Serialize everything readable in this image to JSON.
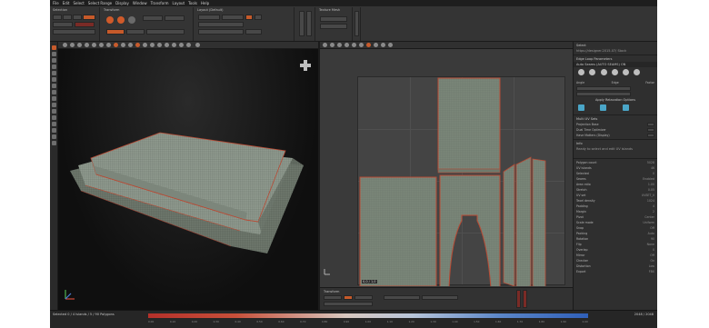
{
  "menu": [
    "File",
    "Edit",
    "Select",
    "Select Range",
    "Display",
    "Window",
    "Transform",
    "Layout",
    "Tools",
    "Help"
  ],
  "toolbar": {
    "group1_title": "Selection",
    "group2_title": "Transform",
    "group3_title": "Layout (Default)",
    "group4_title": "Texture Mesh",
    "side_tab": "Properties"
  },
  "right_panel": {
    "title": "Select",
    "path": "https://designer.2015-07/ Stock",
    "section_unfold": "Edge Loop Parameters",
    "auto_label": "Auto Seams (AUTO SEAMS) ON",
    "opt1": "Angle",
    "opt2": "Edge",
    "opt3": "Factor",
    "apply_button": "Apply Relaxation Options",
    "multi_uv": "Multi UV Sets",
    "projection": "Projection Base",
    "dual_time": "Dual Time Optimizer",
    "hide_label": "Have Matters (Display)",
    "info_header": "Info",
    "info_text": "Ready to select and edit UV islands",
    "rows": [
      {
        "k": "Polygon count",
        "v": "5028"
      },
      {
        "k": "UV islands",
        "v": "46"
      },
      {
        "k": "Selected",
        "v": "0"
      },
      {
        "k": "Seams",
        "v": "Enabled"
      },
      {
        "k": "Area ratio",
        "v": "1.00"
      },
      {
        "k": "Stretch",
        "v": "0.05"
      },
      {
        "k": "UV set",
        "v": "UVSET_0"
      },
      {
        "k": "Texel density",
        "v": "1024"
      },
      {
        "k": "Padding",
        "v": "4"
      },
      {
        "k": "Margin",
        "v": "2"
      },
      {
        "k": "Pivot",
        "v": "Center"
      },
      {
        "k": "Scale mode",
        "v": "Uniform"
      },
      {
        "k": "Snap",
        "v": "Off"
      },
      {
        "k": "Packing",
        "v": "Auto"
      },
      {
        "k": "Rotation",
        "v": "90"
      },
      {
        "k": "Flip",
        "v": "None"
      },
      {
        "k": "Overlap",
        "v": "0"
      },
      {
        "k": "Mirror",
        "v": "Off"
      },
      {
        "k": "Checker",
        "v": "On"
      },
      {
        "k": "Distortion",
        "v": "Low"
      },
      {
        "k": "Export",
        "v": "FBX"
      }
    ]
  },
  "uv_view": {
    "corner_label": "0,0 / 1,0",
    "bottom_title": "Transform",
    "bottom_fields": [
      "U",
      "V",
      "Scale",
      "Angle"
    ]
  },
  "status": {
    "left_text": "Selected 0 / 4 Islands / 5 / 90 Polygons",
    "right_text": "2048 / 2048",
    "ticks": [
      "0.00",
      "0.10",
      "0.20",
      "0.30",
      "0.40",
      "0.50",
      "0.60",
      "0.70",
      "0.80",
      "0.90",
      "1.00",
      "1.10",
      "1.20",
      "1.30",
      "1.40",
      "1.50",
      "1.60",
      "1.70",
      "1.80",
      "1.90",
      "2.00"
    ]
  },
  "colors": {
    "accent": "#c85b2c",
    "uv_island_fill": "#7b8779",
    "uv_island_border": "#b84a34"
  },
  "icons": {
    "gizmo": "axis-gizmo-icon",
    "navcube": "nav-cube-icon"
  }
}
